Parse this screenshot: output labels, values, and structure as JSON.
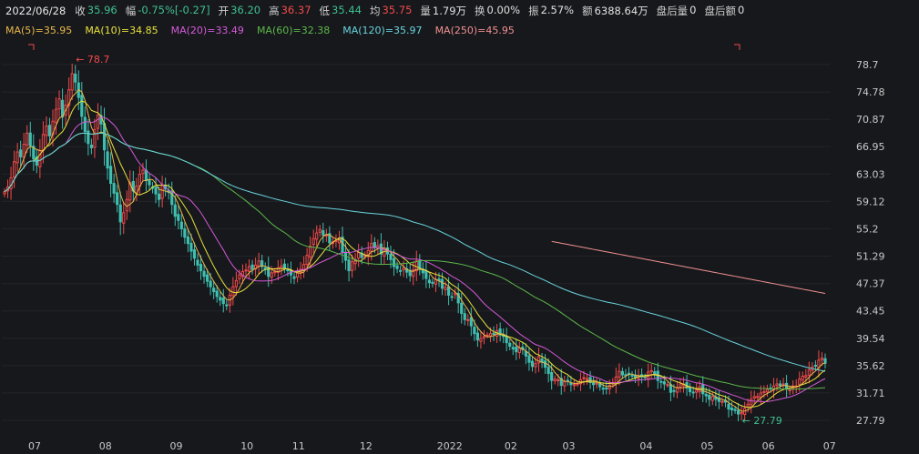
{
  "info_bar": {
    "date": "2022/06/28",
    "fields": [
      {
        "label": "收",
        "value": "35.96",
        "color": "#3fbf8f"
      },
      {
        "label": "幅",
        "value": "-0.75%[-0.27]",
        "color": "#3fbf8f"
      },
      {
        "label": "开",
        "value": "36.20",
        "color": "#3fbf8f"
      },
      {
        "label": "高",
        "value": "36.37",
        "color": "#f24a4a"
      },
      {
        "label": "低",
        "value": "35.44",
        "color": "#3fbf8f"
      },
      {
        "label": "均",
        "value": "35.75",
        "color": "#f24a4a"
      },
      {
        "label": "量",
        "value": "1.79万",
        "color": "#e0e0e0"
      },
      {
        "label": "换",
        "value": "0.00%",
        "color": "#e0e0e0"
      },
      {
        "label": "振",
        "value": "2.57%",
        "color": "#e0e0e0"
      },
      {
        "label": "额",
        "value": "6388.64万",
        "color": "#e0e0e0"
      },
      {
        "label": "盘后量",
        "value": "0",
        "color": "#e0e0e0"
      },
      {
        "label": "盘后额",
        "value": "0",
        "color": "#e0e0e0"
      }
    ]
  },
  "ma_legend": [
    {
      "text": "MA(5)=35.95",
      "color": "#e8b84a"
    },
    {
      "text": "MA(10)=34.85",
      "color": "#e8e23a"
    },
    {
      "text": "MA(20)=33.49",
      "color": "#d45ad8"
    },
    {
      "text": "MA(60)=32.38",
      "color": "#5cb84a"
    },
    {
      "text": "MA(120)=35.97",
      "color": "#68d4dc"
    },
    {
      "text": "MA(250)=45.95",
      "color": "#f09090"
    }
  ],
  "chart_data": {
    "type": "candlestick",
    "y_ticks": [
      "78.7",
      "74.78",
      "70.87",
      "66.95",
      "63.03",
      "59.12",
      "55.2",
      "51.29",
      "47.37",
      "43.45",
      "39.54",
      "35.62",
      "31.71",
      "27.79"
    ],
    "ylim": [
      27.79,
      78.7
    ],
    "x_ticks": [
      {
        "label": "07",
        "pos": 0
      },
      {
        "label": "08",
        "pos": 22
      },
      {
        "label": "09",
        "pos": 44
      },
      {
        "label": "10",
        "pos": 66
      },
      {
        "label": "11",
        "pos": 82
      },
      {
        "label": "12",
        "pos": 103
      },
      {
        "label": "2022",
        "pos": 127
      },
      {
        "label": "02",
        "pos": 148
      },
      {
        "label": "03",
        "pos": 166
      },
      {
        "label": "04",
        "pos": 190
      },
      {
        "label": "05",
        "pos": 209
      },
      {
        "label": "06",
        "pos": 228
      },
      {
        "label": "07",
        "pos": 247
      }
    ],
    "close": [
      60.5,
      61.2,
      62.5,
      64.8,
      66.2,
      65.5,
      67.3,
      68.9,
      67.1,
      65.2,
      64.3,
      66.4,
      68.7,
      69.9,
      68.5,
      70.6,
      72.3,
      73.8,
      71.2,
      72.9,
      75.1,
      77.4,
      76.2,
      74.0,
      71.3,
      69.1,
      67.4,
      66.8,
      69.4,
      71.5,
      70.2,
      66.5,
      63.9,
      61.7,
      60.3,
      58.7,
      56.2,
      57.5,
      59.4,
      61.8,
      60.6,
      61.3,
      63.0,
      63.6,
      62.1,
      61.5,
      61.0,
      60.2,
      59.4,
      61.5,
      60.9,
      60.4,
      58.7,
      57.0,
      56.4,
      55.2,
      54.0,
      53.1,
      52.0,
      51.0,
      50.0,
      49.2,
      48.4,
      47.7,
      46.9,
      46.2,
      45.5,
      45.0,
      44.5,
      44.3,
      45.7,
      46.9,
      47.8,
      48.6,
      49.1,
      49.3,
      49.8,
      49.4,
      50.0,
      50.6,
      49.8,
      49.4,
      48.4,
      48.9,
      49.1,
      49.6,
      49.9,
      49.6,
      49.2,
      48.6,
      48.1,
      48.9,
      49.4,
      50.1,
      51.4,
      52.7,
      53.8,
      54.6,
      55.1,
      54.3,
      54.3,
      53.2,
      53.3,
      53.5,
      53.9,
      51.8,
      50.7,
      49.2,
      50.5,
      50.8,
      51.8,
      51.1,
      51.4,
      52.1,
      53.1,
      52.5,
      52.8,
      51.6,
      52.4,
      51.6,
      50.8,
      49.8,
      49.5,
      49.2,
      49.6,
      49.0,
      48.5,
      49.3,
      50.6,
      49.5,
      48.9,
      48.1,
      47.5,
      47.4,
      47.9,
      47.8,
      46.7,
      46.8,
      45.7,
      45.5,
      46.0,
      44.6,
      43.1,
      42.2,
      42.2,
      41.3,
      40.2,
      39.3,
      39.5,
      39.8,
      40.0,
      40.2,
      40.1,
      40.6,
      40.0,
      39.8,
      38.9,
      38.4,
      38.0,
      37.6,
      38.1,
      37.9,
      37.0,
      36.1,
      35.5,
      35.9,
      36.9,
      36.1,
      35.4,
      34.5,
      33.5,
      33.7,
      33.6,
      32.8,
      33.3,
      33.4,
      32.9,
      32.9,
      33.0,
      33.6,
      33.9,
      33.8,
      33.2,
      32.9,
      33.1,
      32.6,
      32.3,
      32.4,
      32.8,
      33.2,
      34.0,
      34.8,
      34.3,
      34.3,
      34.5,
      34.2,
      33.9,
      34.1,
      34.0,
      33.9,
      34.7,
      34.9,
      34.5,
      33.5,
      33.3,
      33.0,
      32.9,
      31.8,
      32.0,
      32.5,
      33.0,
      33.0,
      32.4,
      31.9,
      31.8,
      32.1,
      32.6,
      31.6,
      31.3,
      30.8,
      31.2,
      30.8,
      30.5,
      30.5,
      30.4,
      29.4,
      29.3,
      29.2,
      28.7,
      28.9,
      29.5,
      30.1,
      30.8,
      31.2,
      31.2,
      31.7,
      31.9,
      32.2,
      32.4,
      32.7,
      33.0,
      32.8,
      33.0,
      32.3,
      32.2,
      32.7,
      32.7,
      33.7,
      34.1,
      34.2,
      35.0,
      35.4,
      35.6,
      36.4,
      36.7,
      35.96
    ],
    "ma_periods": [
      5,
      10,
      20,
      60,
      120,
      250
    ],
    "ma250_reference": [
      45.0,
      53.4,
      45.95
    ],
    "annotations": [
      {
        "text": "78.7",
        "kind": "high"
      },
      {
        "text": "27.79",
        "kind": "low"
      }
    ]
  }
}
